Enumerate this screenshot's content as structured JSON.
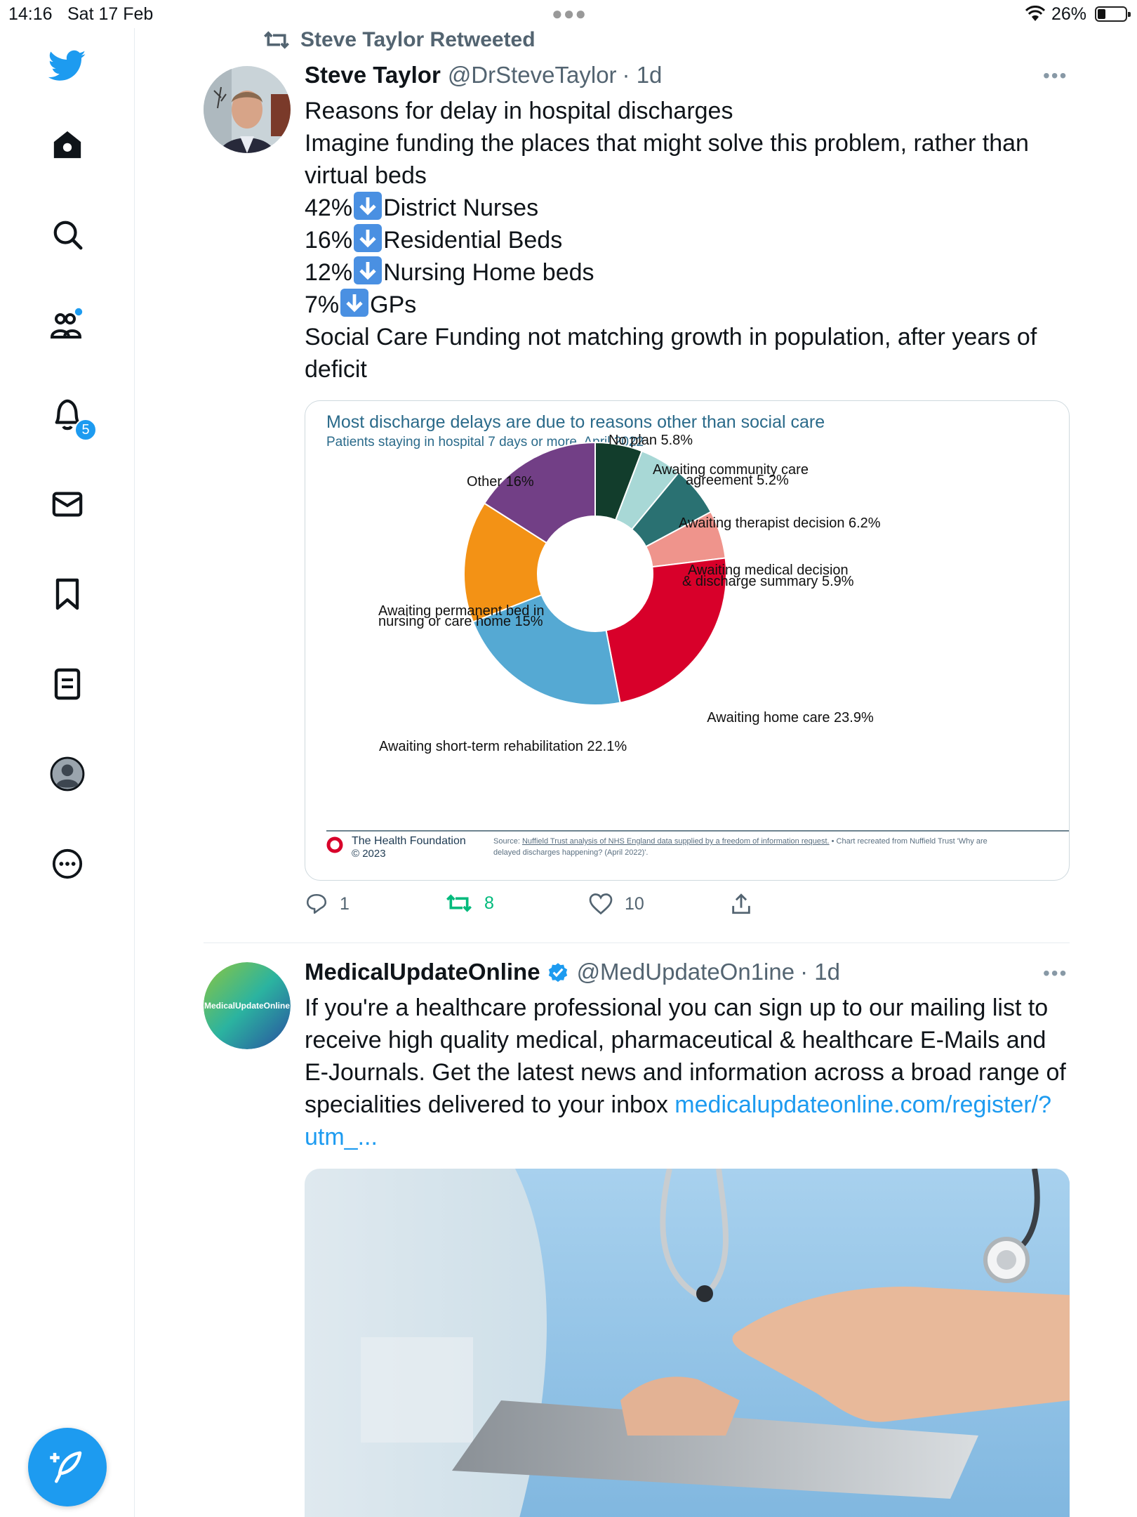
{
  "status_bar": {
    "time": "14:16",
    "date": "Sat 17 Feb",
    "battery_pct": "26%"
  },
  "sidebar": {
    "items": [
      {
        "name": "twitter-logo-icon"
      },
      {
        "name": "home-icon"
      },
      {
        "name": "explore-icon"
      },
      {
        "name": "communities-icon"
      },
      {
        "name": "notifications-icon"
      },
      {
        "name": "messages-icon"
      },
      {
        "name": "bookmarks-icon"
      },
      {
        "name": "lists-icon"
      },
      {
        "name": "profile-icon"
      },
      {
        "name": "more-icon"
      }
    ],
    "notification_count": "5",
    "accent": "#1d9bf0"
  },
  "tweet1": {
    "retweet_label": "Steve Taylor Retweeted",
    "name": "Steve Taylor",
    "handle": "@DrSteveTaylor",
    "time": "· 1d",
    "lines": [
      "Reasons for delay in hospital discharges",
      "Imagine funding the places that might solve this problem, rather than",
      "virtual beds"
    ],
    "stats": [
      {
        "pct": "42%",
        "label": "District Nurses"
      },
      {
        "pct": "16%",
        "label": "Residential Beds"
      },
      {
        "pct": "12%",
        "label": "Nursing Home beds"
      },
      {
        "pct": "7%",
        "label": "GPs"
      }
    ],
    "closing_lines": [
      "Social Care Funding not matching growth in population, after years of",
      "deficit"
    ],
    "replies": "1",
    "retweets": "8",
    "likes": "10"
  },
  "chart_card": {
    "title": "Most discharge delays are due to reasons other than social care",
    "subtitle": "Patients staying in hospital 7 days or more, April 2022",
    "footer_org": "The Health Foundation",
    "footer_year": "© 2023",
    "source_prefix": "Source: ",
    "source_link": "Nuffield Trust analysis of NHS England data supplied by a freedom of information request.",
    "source_rest": " • Chart recreated from Nuffield Trust 'Why are",
    "source_line2": "delayed discharges happening? (April 2022)'."
  },
  "chart_data": {
    "type": "pie",
    "title": "Most discharge delays are due to reasons other than social care",
    "subtitle": "Patients staying in hospital 7 days or more, April 2022",
    "categories": [
      "No plan",
      "Awaiting community care agreement",
      "Awaiting therapist decision",
      "Awaiting medical decision & discharge summary",
      "Awaiting home care",
      "Awaiting short-term rehabilitation",
      "Awaiting permanent bed in nursing or care home",
      "Other"
    ],
    "values": [
      5.8,
      5.2,
      6.2,
      5.9,
      23.9,
      22.1,
      15,
      16
    ],
    "colors": [
      "#123d2c",
      "#a8d8d6",
      "#2a7172",
      "#ef948c",
      "#d8002a",
      "#55a9d3",
      "#f39215",
      "#723f86"
    ],
    "labels": [
      [
        "No plan 5.8%"
      ],
      [
        "Awaiting community care",
        "agreement 5.2%"
      ],
      [
        "Awaiting therapist decision 6.2%"
      ],
      [
        "Awaiting medical decision",
        "& discharge summary 5.9%"
      ],
      [
        "Awaiting home care 23.9%"
      ],
      [
        "Awaiting short-term rehabilitation 22.1%"
      ],
      [
        "Awaiting permanent bed in",
        "nursing or care home 15%"
      ],
      [
        "Other 16%"
      ]
    ]
  },
  "tweet2": {
    "name": "MedicalUpdateOnline",
    "handle": "@MedUpdateOn1ine",
    "time": "· 1d",
    "avatar_text": "MedicalUpdateOnline",
    "lines": [
      "If you're a healthcare professional you can sign up to our mailing list to",
      "receive high quality medical, pharmaceutical & healthcare E-Mails and",
      "E-Journals. Get the latest news and information across a broad range of"
    ],
    "line4_text": "specialities delivered to your inbox ",
    "link1": "medicalupdateonline.com/register/?",
    "link2": "utm_..."
  }
}
